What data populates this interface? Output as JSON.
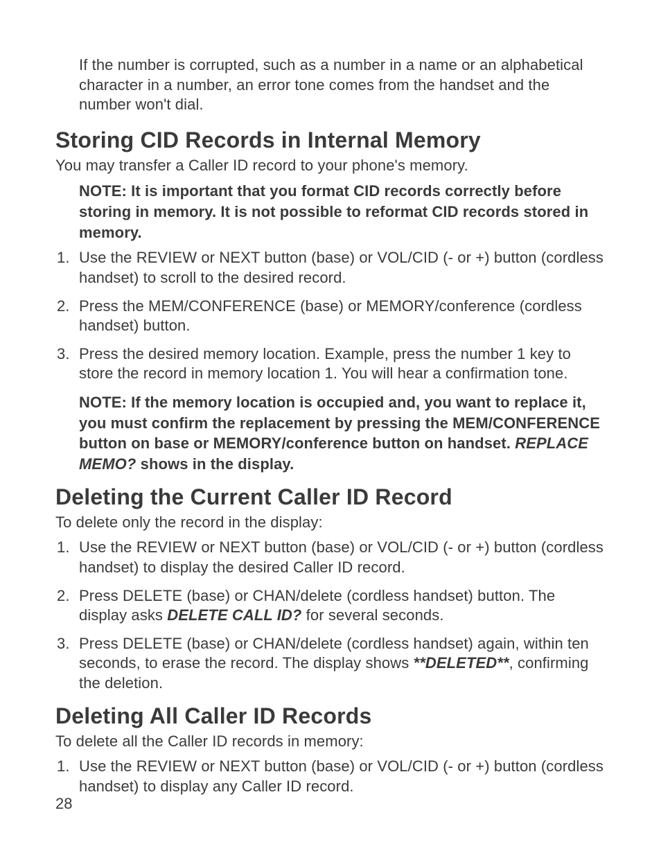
{
  "intro": "If the number is corrupted, such as a number in a name or an alphabetical character in a number, an error tone comes from the handset and the number won't dial.",
  "sections": [
    {
      "heading": "Storing CID Records in Internal Memory",
      "lead": "You may transfer a Caller ID record to your phone's memory.",
      "note_top": "NOTE: It is important that you format CID records correctly before storing in memory. It is not possible to reformat CID records stored in memory.",
      "items": [
        "Use the REVIEW or NEXT button (base) or VOL/CID (- or +) button (cordless handset) to scroll to the desired record.",
        "Press the MEM/CONFERENCE (base) or MEMORY/conference (cordless handset) button.",
        "Press the desired memory location. Example, press the number 1 key to store the record in memory location 1. You will hear a confirmation tone."
      ],
      "note_bottom_pre": "NOTE: If the memory location is occupied and, you want to replace it, you must confirm the replacement by pressing the MEM/CONFERENCE button on base or MEMORY/conference button on handset. ",
      "note_bottom_em": "REPLACE MEMO?",
      "note_bottom_post": " shows in the display."
    },
    {
      "heading": "Deleting the Current Caller ID Record",
      "lead": "To delete only the record in the display:",
      "items": [
        {
          "pre": "Use the REVIEW or NEXT button (base) or VOL/CID (- or +) button (cordless handset) to display the desired Caller ID record."
        },
        {
          "pre": "Press DELETE (base) or CHAN/delete (cordless handset) button. The display asks ",
          "em": "DELETE CALL ID?",
          "post": " for several seconds."
        },
        {
          "pre": "Press DELETE (base) or CHAN/delete (cordless handset) again, within ten seconds, to erase the record. The display shows ",
          "em": "**DELETED**",
          "post": ", confirming the deletion."
        }
      ]
    },
    {
      "heading": "Deleting All Caller ID Records",
      "lead": "To delete all the Caller ID records in memory:",
      "items": [
        "Use the REVIEW or NEXT button (base) or VOL/CID (- or +) button (cordless handset) to display any Caller ID record."
      ]
    }
  ],
  "page_number": "28"
}
